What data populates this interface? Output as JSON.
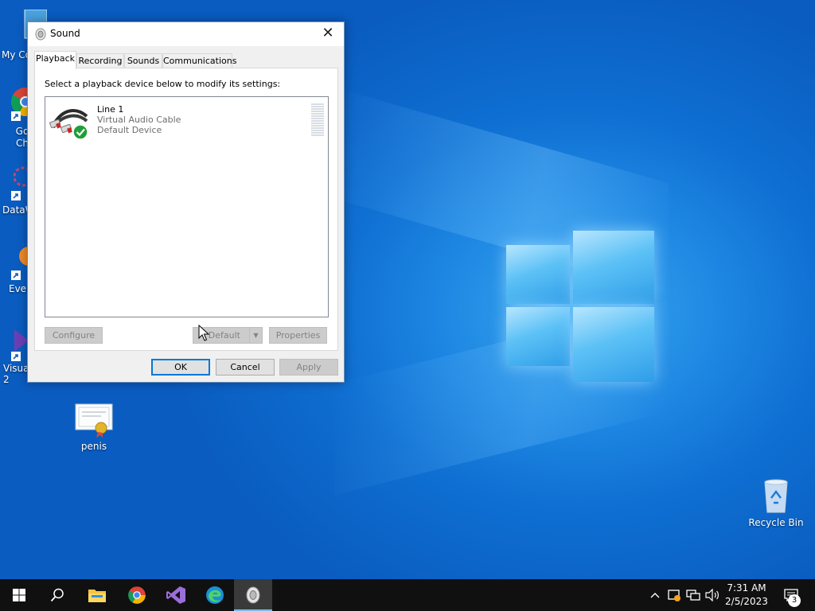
{
  "desktop": {
    "icons": [
      {
        "label": "My Co"
      },
      {
        "label": "Go Ch"
      },
      {
        "label": "DataW"
      },
      {
        "label": "Ever"
      },
      {
        "label": "Visua 2"
      },
      {
        "label": "penis"
      },
      {
        "label": "Recycle Bin"
      }
    ]
  },
  "dialog": {
    "title": "Sound",
    "close_glyph": "✕",
    "tabs": [
      {
        "label": "Playback",
        "active": true
      },
      {
        "label": "Recording",
        "active": false
      },
      {
        "label": "Sounds",
        "active": false
      },
      {
        "label": "Communications",
        "active": false
      }
    ],
    "instruction": "Select a playback device below to modify its settings:",
    "devices": [
      {
        "name": "Line 1",
        "driver": "Virtual Audio Cable",
        "status": "Default Device"
      }
    ],
    "buttons": {
      "configure": "Configure",
      "set_default": "t Default",
      "properties": "Properties",
      "ok": "OK",
      "cancel": "Cancel",
      "apply": "Apply"
    }
  },
  "taskbar": {
    "apps": [
      "start-icon",
      "search-icon",
      "file-explorer-icon",
      "chrome-icon",
      "visual-studio-icon",
      "edge-icon",
      "sound-app-icon"
    ],
    "tray": {
      "chevron": "^",
      "time": "7:31 AM",
      "date": "2/5/2023",
      "notification_count": "3"
    }
  },
  "colors": {
    "accent": "#0078d7",
    "taskbar": "#101010",
    "desktop": "#0a63c8"
  }
}
